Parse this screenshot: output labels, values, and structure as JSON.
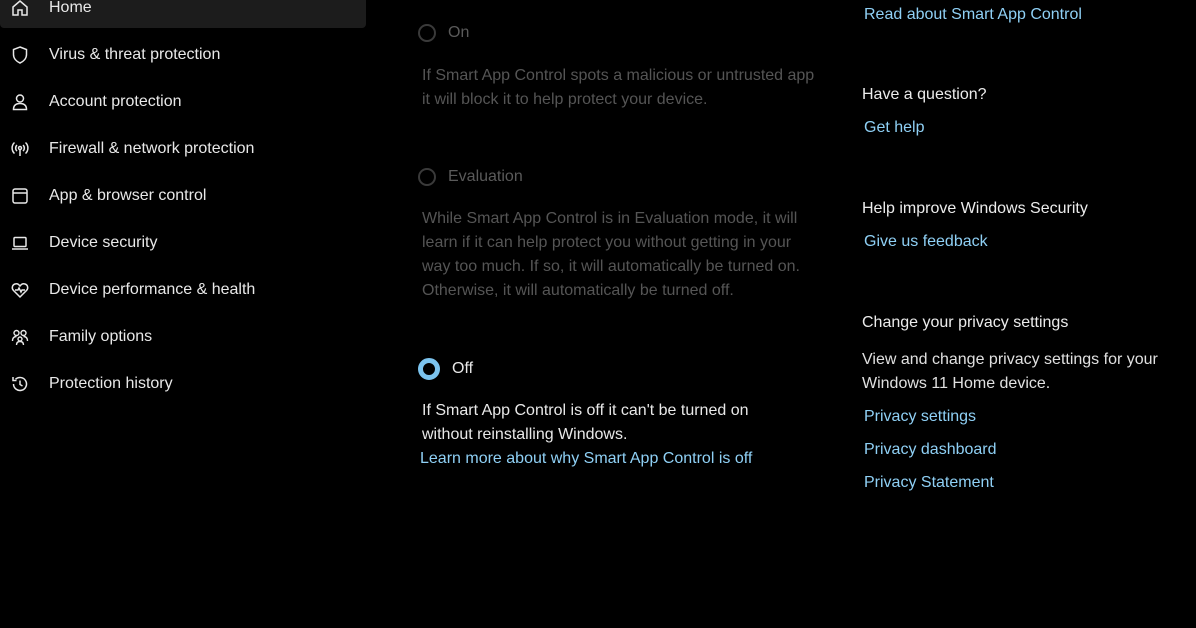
{
  "sidebar": {
    "items": [
      {
        "label": "Home",
        "icon": "home-icon",
        "active": true
      },
      {
        "label": "Virus & threat protection",
        "icon": "shield-icon"
      },
      {
        "label": "Account protection",
        "icon": "person-icon"
      },
      {
        "label": "Firewall & network protection",
        "icon": "antenna-icon"
      },
      {
        "label": "App & browser control",
        "icon": "app-window-icon"
      },
      {
        "label": "Device security",
        "icon": "laptop-icon"
      },
      {
        "label": "Device performance & health",
        "icon": "heart-pulse-icon"
      },
      {
        "label": "Family options",
        "icon": "family-icon"
      },
      {
        "label": "Protection history",
        "icon": "history-icon"
      }
    ]
  },
  "options": {
    "on": {
      "label": "On",
      "description": "If Smart App Control spots a malicious or untrusted app it will block it to help protect your device."
    },
    "evaluation": {
      "label": "Evaluation",
      "description": "While Smart App Control is in Evaluation mode, it will learn if it can help protect you without getting in your way too much. If so, it will automatically be turned on. Otherwise, it will automatically be turned off."
    },
    "off": {
      "label": "Off",
      "description": "If Smart App Control is off it can't be turned on without reinstalling Windows.",
      "link": "Learn more about why Smart App Control is off",
      "selected": true
    }
  },
  "right": {
    "read_about_link": "Read about Smart App Control",
    "question": {
      "heading": "Have a question?",
      "link": "Get help"
    },
    "improve": {
      "heading": "Help improve Windows Security",
      "link": "Give us feedback"
    },
    "privacy": {
      "heading": "Change your privacy settings",
      "text": "View and change privacy settings for your Windows 11 Home device.",
      "links": [
        "Privacy settings",
        "Privacy dashboard",
        "Privacy Statement"
      ]
    }
  },
  "colors": {
    "background": "#000000",
    "accent_link": "#8fd0f5",
    "radio_checked": "#7cc4ef",
    "disabled_text": "#555555"
  }
}
